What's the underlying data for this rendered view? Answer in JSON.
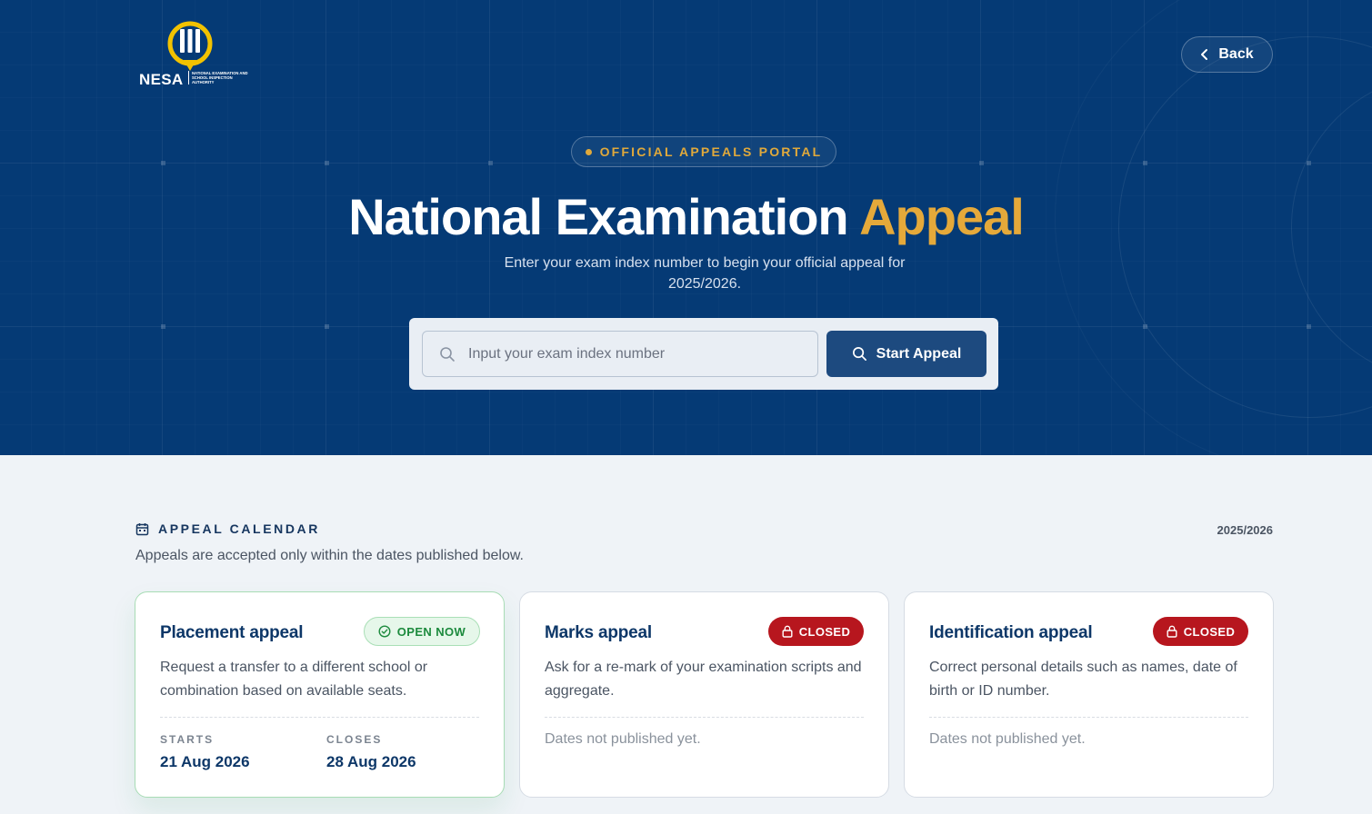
{
  "header": {
    "logo_text": "NESA",
    "logo_subtext": "NATIONAL EXAMINATION AND SCHOOL INSPECTION AUTHORITY",
    "back_label": "Back"
  },
  "hero": {
    "pill_label": "OFFICIAL APPEALS PORTAL",
    "title_main": "National Examination",
    "title_accent": "Appeal",
    "subtitle": "Enter your exam index number to begin your official appeal for 2025/2026."
  },
  "search": {
    "placeholder": "Input your exam index number",
    "value": "",
    "button_label": "Start Appeal"
  },
  "calendar": {
    "heading": "APPEAL CALENDAR",
    "year": "2025/2026",
    "subtitle": "Appeals are accepted only within the dates published below.",
    "cards": [
      {
        "title": "Placement appeal",
        "status": "OPEN NOW",
        "description": "Request a transfer to a different school or combination based on available seats.",
        "starts_label": "STARTS",
        "starts": "21 Aug 2026",
        "closes_label": "CLOSES",
        "closes": "28 Aug 2026"
      },
      {
        "title": "Marks appeal",
        "status": "CLOSED",
        "description": "Ask for a re-mark of your examination scripts and aggregate.",
        "dates_note": "Dates not published yet."
      },
      {
        "title": "Identification appeal",
        "status": "CLOSED",
        "description": "Correct personal details such as names, date of birth or ID number.",
        "dates_note": "Dates not published yet."
      }
    ]
  },
  "colors": {
    "hero_bg": "#053a75",
    "accent_gold": "#e5a93a",
    "button_blue": "#1d4a7f",
    "open_green": "#1c8a3d",
    "closed_red": "#b7161e",
    "card_title": "#0d3768"
  },
  "icons": {
    "back": "chevron-left-icon",
    "search": "search-icon",
    "calendar": "calendar-icon",
    "open": "check-circle-icon",
    "closed": "lock-icon"
  }
}
